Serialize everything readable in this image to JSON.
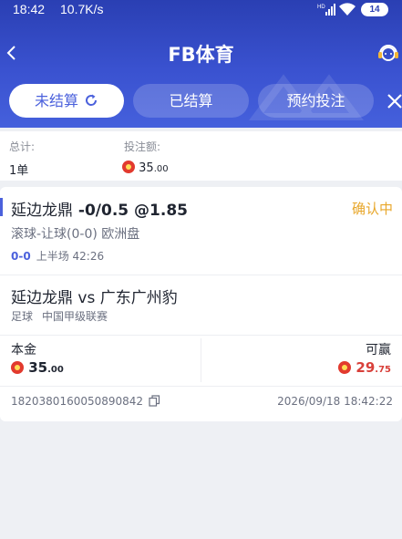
{
  "statusbar": {
    "time": "18:42",
    "net_speed": "10.7K/s",
    "signal_label": "HD",
    "battery": "14"
  },
  "navbar": {
    "title": "FB体育"
  },
  "tabs": [
    {
      "label": "未结算",
      "active": true
    },
    {
      "label": "已结算",
      "active": false
    },
    {
      "label": "预约投注",
      "active": false
    }
  ],
  "summary": {
    "total_label": "总计:",
    "total_value": "1单",
    "amount_label": "投注额:",
    "amount_int": "35",
    "amount_dec": ".00"
  },
  "bet": {
    "team": "延边龙鼎",
    "selection": "-0/0.5 @1.85",
    "status": "确认中",
    "market": "滚球-让球(0-0) 欧洲盘",
    "score": "0-0",
    "period": "上半场 42:26",
    "match": "延边龙鼎 vs 广东广州豹",
    "sport": "足球",
    "league": "中国甲级联赛",
    "stake_label": "本金",
    "stake_int": "35",
    "stake_dec": ".00",
    "win_label": "可赢",
    "win_int": "29",
    "win_dec": ".75",
    "order_id": "1820380160050890842",
    "datetime": "2026/09/18 18:42:22"
  },
  "colors": {
    "header": "#3a52d0",
    "accent": "#4b61dc",
    "pending": "#e8a72b",
    "win": "#d8403a"
  }
}
